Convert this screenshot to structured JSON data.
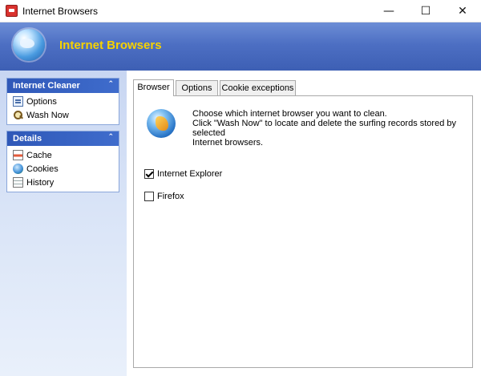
{
  "window": {
    "title": "Internet Browsers",
    "controls": {
      "minimize": "—",
      "maximize": "☐",
      "close": "✕"
    }
  },
  "banner": {
    "title": "Internet Browsers",
    "icon": "globe-icon"
  },
  "sidebar": {
    "groups": [
      {
        "title": "Internet Cleaner",
        "collapse_glyph": "⌃",
        "items": [
          {
            "label": "Options",
            "icon": "options-icon"
          },
          {
            "label": "Wash Now",
            "icon": "magnifier-icon"
          }
        ]
      },
      {
        "title": "Details",
        "collapse_glyph": "⌃",
        "items": [
          {
            "label": "Cache",
            "icon": "cache-icon"
          },
          {
            "label": "Cookies",
            "icon": "cookies-icon"
          },
          {
            "label": "History",
            "icon": "history-icon"
          }
        ]
      }
    ]
  },
  "main": {
    "tabs": [
      {
        "label": "Browser",
        "active": true
      },
      {
        "label": "Options",
        "active": false
      },
      {
        "label": "Cookie exceptions",
        "active": false
      }
    ],
    "description": {
      "line1": "Choose which internet browser you want to clean.",
      "line2": "Click \"Wash Now\" to locate and delete the surfing records stored by selected",
      "line3": "Internet browsers."
    },
    "browsers": [
      {
        "label": "Internet Explorer",
        "checked": true
      },
      {
        "label": "Firefox",
        "checked": false
      }
    ]
  }
}
